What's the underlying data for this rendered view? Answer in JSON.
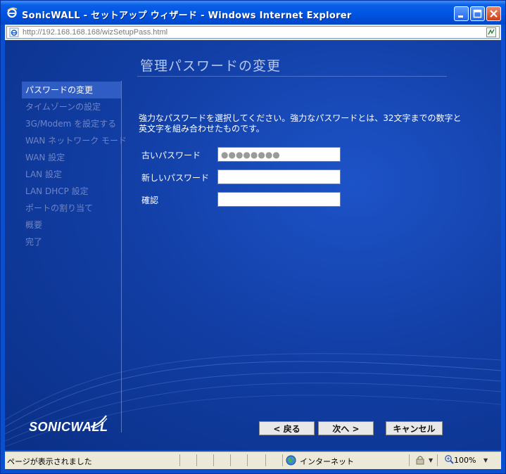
{
  "window": {
    "title": "SonicWALL - セットアップ ウィザード - Windows Internet Explorer",
    "address_base": "http://192.168.168.168",
    "address_path": "/wizSetupPass.html"
  },
  "page": {
    "heading": "管理パスワードの変更",
    "description_line1": "強力なパスワードを選択してください。強力なパスワードとは、32文字までの数字と",
    "description_line2": "英文字を組み合わせたものです。"
  },
  "nav": {
    "items": [
      {
        "label": "パスワードの変更",
        "active": true
      },
      {
        "label": "タイムゾーンの設定",
        "active": false
      },
      {
        "label": "3G/Modem を設定する",
        "active": false
      },
      {
        "label": "WAN ネットワーク モード",
        "active": false
      },
      {
        "label": "WAN 設定",
        "active": false
      },
      {
        "label": "LAN 設定",
        "active": false
      },
      {
        "label": "LAN DHCP 設定",
        "active": false
      },
      {
        "label": "ポートの割り当て",
        "active": false
      },
      {
        "label": "概要",
        "active": false
      },
      {
        "label": "完了",
        "active": false
      }
    ]
  },
  "form": {
    "old_password_label": "古いパスワード",
    "old_password_value": "●●●●●●●●",
    "new_password_label": "新しいパスワード",
    "new_password_value": "",
    "confirm_label": "確認",
    "confirm_value": ""
  },
  "buttons": {
    "back": "< 戻る",
    "next": "次へ >",
    "cancel": "キャンセル"
  },
  "brand": {
    "logo": "SONICWALL"
  },
  "status": {
    "text": "ページが表示されました",
    "zone": "インターネット",
    "zoom": "100%"
  },
  "colors": {
    "background": "#123fa6",
    "nav_active": "#2f5dc4",
    "nav_inactive_text": "#6f85c4",
    "heading": "#b8c8ec"
  }
}
